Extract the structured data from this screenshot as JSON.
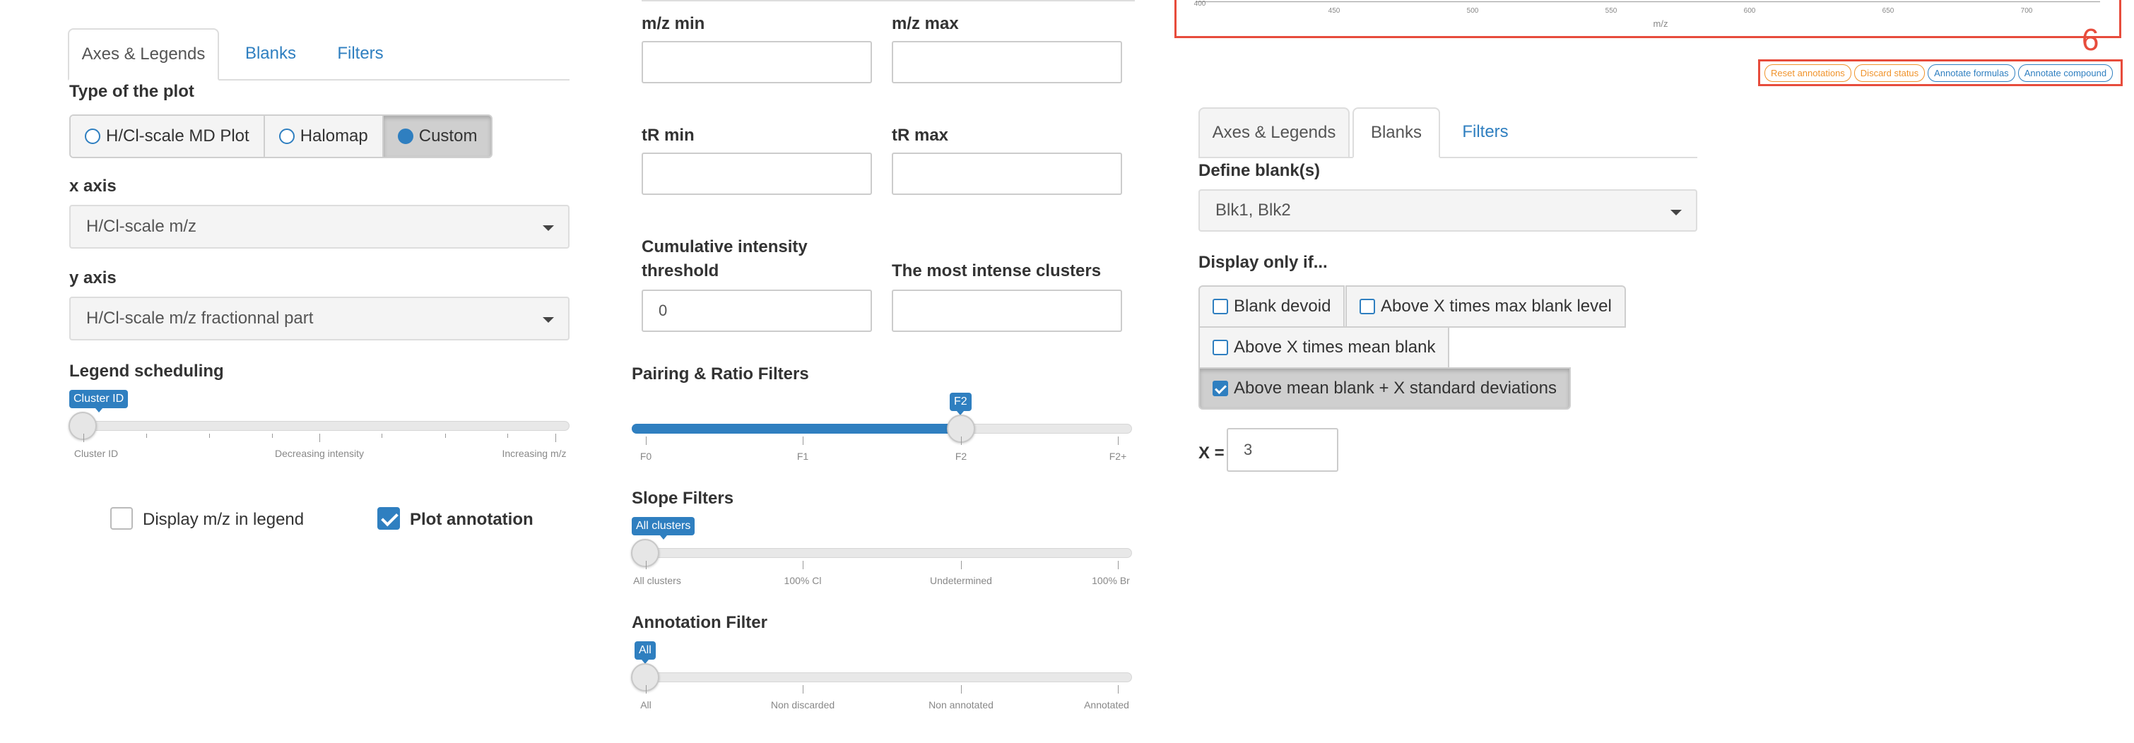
{
  "left_panel": {
    "tabs": [
      "Axes & Legends",
      "Blanks",
      "Filters"
    ],
    "plot_type": {
      "label": "Type of the plot",
      "options": [
        "H/Cl-scale MD Plot",
        "Halomap",
        "Custom"
      ],
      "selected": "Custom"
    },
    "x_axis": {
      "label": "x axis",
      "value": "H/Cl-scale m/z"
    },
    "y_axis": {
      "label": "y axis",
      "value": "H/Cl-scale m/z fractionnal part"
    },
    "legend_scheduling": {
      "label": "Legend scheduling",
      "value": "Cluster ID",
      "ticks": [
        "Cluster ID",
        "Decreasing intensity",
        "Increasing m/z"
      ]
    },
    "display_mz_legend": {
      "label": "Display m/z in legend",
      "checked": false
    },
    "plot_annotation": {
      "label": "Plot annotation",
      "checked": true
    }
  },
  "middle_panel": {
    "mz_min": {
      "label": "m/z min",
      "value": ""
    },
    "mz_max": {
      "label": "m/z max",
      "value": ""
    },
    "tr_min": {
      "label": "tR min",
      "value": ""
    },
    "tr_max": {
      "label": "tR max",
      "value": ""
    },
    "cum_intensity": {
      "label_line1": "Cumulative intensity",
      "label_line2": "threshold",
      "value": "0"
    },
    "most_intense": {
      "label": "The most intense clusters",
      "value": ""
    },
    "pairing_filter": {
      "label": "Pairing & Ratio Filters",
      "value": "F2",
      "ticks": [
        "F0",
        "F1",
        "F2",
        "F2+"
      ]
    },
    "slope_filter": {
      "label": "Slope Filters",
      "value": "All clusters",
      "ticks": [
        "All clusters",
        "100% Cl",
        "Undetermined",
        "100% Br"
      ]
    },
    "annotation_filter": {
      "label": "Annotation Filter",
      "value": "All",
      "ticks": [
        "All",
        "Non discarded",
        "Non annotated",
        "Annotated"
      ]
    }
  },
  "right_panel": {
    "chart_axis": {
      "ticks": [
        "400",
        "450",
        "500",
        "550",
        "600",
        "650",
        "700"
      ],
      "xlabel": "m/z"
    },
    "step_number": "6",
    "annotation_buttons": [
      "Reset annotations",
      "Discard status",
      "Annotate formulas",
      "Annotate compound"
    ],
    "tabs": [
      "Axes & Legends",
      "Blanks",
      "Filters"
    ],
    "define_blanks": {
      "label": "Define blank(s)",
      "value": "Blk1, Blk2"
    },
    "display_only_if": {
      "label": "Display only if...",
      "options": [
        "Blank devoid",
        "Above X times max blank level",
        "Above X times mean blank",
        "Above mean blank + X standard deviations"
      ],
      "checked": "Above mean blank + X standard deviations"
    },
    "x_value": {
      "label": "X =",
      "value": "3"
    }
  },
  "colors": {
    "accent": "#2f7fc0",
    "highlight": "#e74c3c",
    "orange": "#f0932b"
  }
}
